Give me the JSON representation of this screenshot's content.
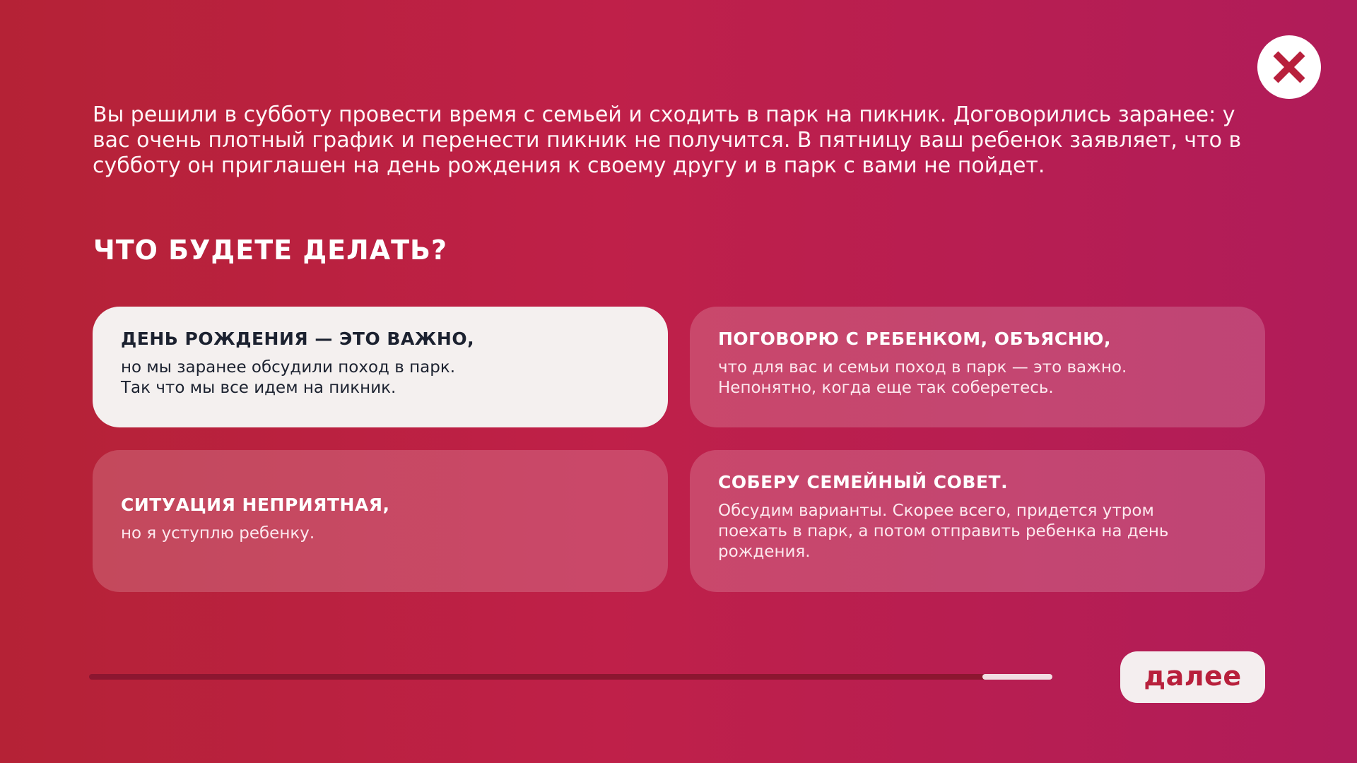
{
  "icons": {
    "close": "close-icon"
  },
  "colors": {
    "background_start": "#b52236",
    "background_end": "#b01c5a",
    "selected_card": "#f4f0ef",
    "accent": "#b8203c"
  },
  "scenario": {
    "text": "Вы решили в субботу провести время с семьей и сходить в парк на пикник. Договорились заранее: у вас очень плотный график и перенести пикник не получится. В пятницу ваш ребенок заявляет, что в субботу он приглашен на день рождения к своему другу и в парк с вами не пойдет."
  },
  "question": "ЧТО БУДЕТЕ ДЕЛАТЬ?",
  "options": [
    {
      "title": "ДЕНЬ РОЖДЕНИЯ — ЭТО ВАЖНО,",
      "text": "но мы заранее обсудили поход в парк.\nТак что мы все идем на пикник.",
      "selected": true
    },
    {
      "title": "ПОГОВОРЮ С РЕБЕНКОМ, ОБЪЯСНЮ,",
      "text": "что для вас и семьи поход в парк — это важно.\nНепонятно, когда еще так соберетесь.",
      "selected": false
    },
    {
      "title": "СИТУАЦИЯ НЕПРИЯТНАЯ,",
      "text": "но я уступлю ребенку.",
      "selected": false
    },
    {
      "title": "СОБЕРУ СЕМЕЙНЫЙ СОВЕТ.",
      "text": "Обсудим варианты. Скорее всего, придется утром\nпоехать в парк, а потом отправить ребенка на день\nрождения.",
      "selected": false
    }
  ],
  "progress": {
    "value": 0.93
  },
  "next_button": {
    "label": "далее"
  }
}
